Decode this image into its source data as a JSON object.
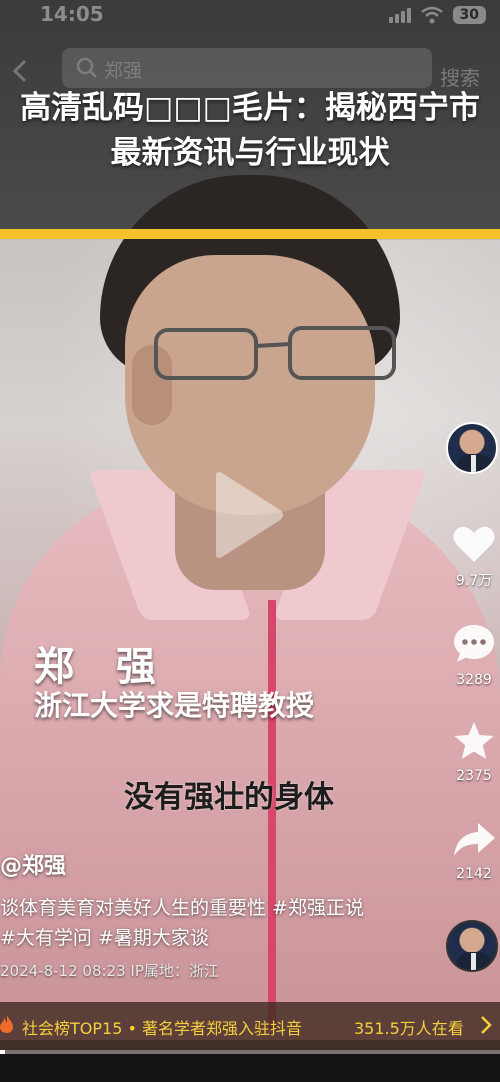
{
  "status_bar": {
    "time": "14:05",
    "battery": "30"
  },
  "search": {
    "query": "郑强",
    "button": "搜索"
  },
  "headline": "高清乱码□□□毛片：揭秘西宁市最新资讯与行业现状",
  "video": {
    "caption_name": "郑 强",
    "caption_role": "浙江大学求是特聘教授",
    "caption_subtitle": "没有强壮的身体",
    "progress": 0.01
  },
  "actions": {
    "likes": "9.7万",
    "comments": "3289",
    "favorites": "2375",
    "shares": "2142"
  },
  "post": {
    "author": "@郑强",
    "description": "谈体育美育对美好人生的重要性 #郑强正说 #大有学问 #暑期大家谈",
    "meta": "2024-8-12 08:23  IP属地：浙江"
  },
  "hot": {
    "title": "社会榜TOP15 • 著名学者郑强入驻抖音",
    "count": "351.5万人在看"
  },
  "colors": {
    "accent_yellow": "#f5c22e",
    "hot_text": "#f7cf3c"
  },
  "icons": [
    "back-icon",
    "search-icon",
    "play-icon",
    "heart-icon",
    "comment-icon",
    "star-icon",
    "share-icon",
    "fire-icon",
    "chevron-right-icon"
  ]
}
